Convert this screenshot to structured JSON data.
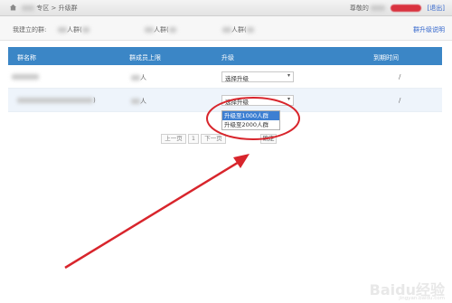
{
  "header": {
    "crumb_area": "专区",
    "crumb_sep": ">",
    "crumb_page": "升级群",
    "greeting": "尊敬的",
    "quit": "[退出]"
  },
  "groups": {
    "label": "我建立的群:",
    "items": [
      "人群(",
      "人群(",
      "人群("
    ],
    "help": "群升级说明"
  },
  "table": {
    "headers": [
      "群名称",
      "群成员上限",
      "升级",
      "到期时间"
    ],
    "rows": [
      {
        "members_unit": "人",
        "select": "选择升级",
        "expire": "/"
      },
      {
        "name_suffix": ")",
        "members_unit": "人",
        "select": "选择升级",
        "expire": "/"
      }
    ]
  },
  "dropdown": {
    "options": [
      "升级至1000人群",
      "升级至2000人群"
    ],
    "highlighted": 0
  },
  "pager": {
    "prev": "上一页",
    "page": "1",
    "next": "下一页",
    "confirm": "确定"
  },
  "annotation_colors": {
    "circle": "#d8252c",
    "arrow": "#d8252c"
  },
  "watermark": {
    "text": "Baidu经验",
    "sub": "jingyan.baidu.com"
  }
}
